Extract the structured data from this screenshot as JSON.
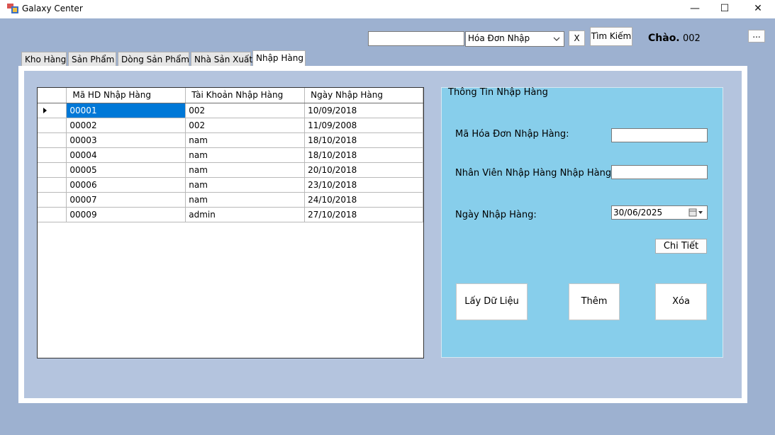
{
  "window": {
    "title": "Galaxy Center",
    "minimize_icon": "minimize-icon",
    "maximize_icon": "maximize-icon",
    "close_icon": "close-icon"
  },
  "toolbar": {
    "search_value": "",
    "filter_selected": "Hóa Đơn Nhập",
    "clear_label": "X",
    "search_label": "Tìm Kiếm",
    "greeting": "Chào.",
    "username": "002",
    "menu_label": "..."
  },
  "tabs": [
    {
      "label": "Kho Hàng",
      "active": false
    },
    {
      "label": "Sản Phẩm",
      "active": false
    },
    {
      "label": "Dòng Sản Phẩm",
      "active": false
    },
    {
      "label": "Nhà Sản Xuất",
      "active": false
    },
    {
      "label": "Nhập Hàng",
      "active": true
    }
  ],
  "grid": {
    "columns": [
      "Mã HD Nhập Hàng",
      "Tài Khoản Nhập Hàng",
      "Ngày Nhập Hàng"
    ],
    "rows": [
      [
        "00001",
        "002",
        "10/09/2018"
      ],
      [
        "00002",
        "002",
        "11/09/2008"
      ],
      [
        "00003",
        "nam",
        "18/10/2018"
      ],
      [
        "00004",
        "nam",
        "18/10/2018"
      ],
      [
        "00005",
        "nam",
        "20/10/2018"
      ],
      [
        "00006",
        "nam",
        "23/10/2018"
      ],
      [
        "00007",
        "nam",
        "24/10/2018"
      ],
      [
        "00009",
        "admin",
        "27/10/2018"
      ]
    ],
    "selected_row": 0
  },
  "details": {
    "title": "Thông Tin Nhập Hàng",
    "invoice_label": "Mã Hóa Đơn Nhập Hàng:",
    "invoice_value": "",
    "employee_label": "Nhân Viên Nhập Hàng Nhập Hàng:",
    "employee_value": "",
    "date_label": "Ngày Nhập Hàng:",
    "date_value": "30/06/2025",
    "detail_button": "Chi Tiết",
    "load_button": "Lấy Dữ Liệu",
    "add_button": "Thêm",
    "delete_button": "Xóa"
  },
  "colors": {
    "window_bg": "#9db1d0",
    "panel_bg": "#b4c4de",
    "details_bg": "#87ceeb",
    "selection": "#0078d7"
  }
}
